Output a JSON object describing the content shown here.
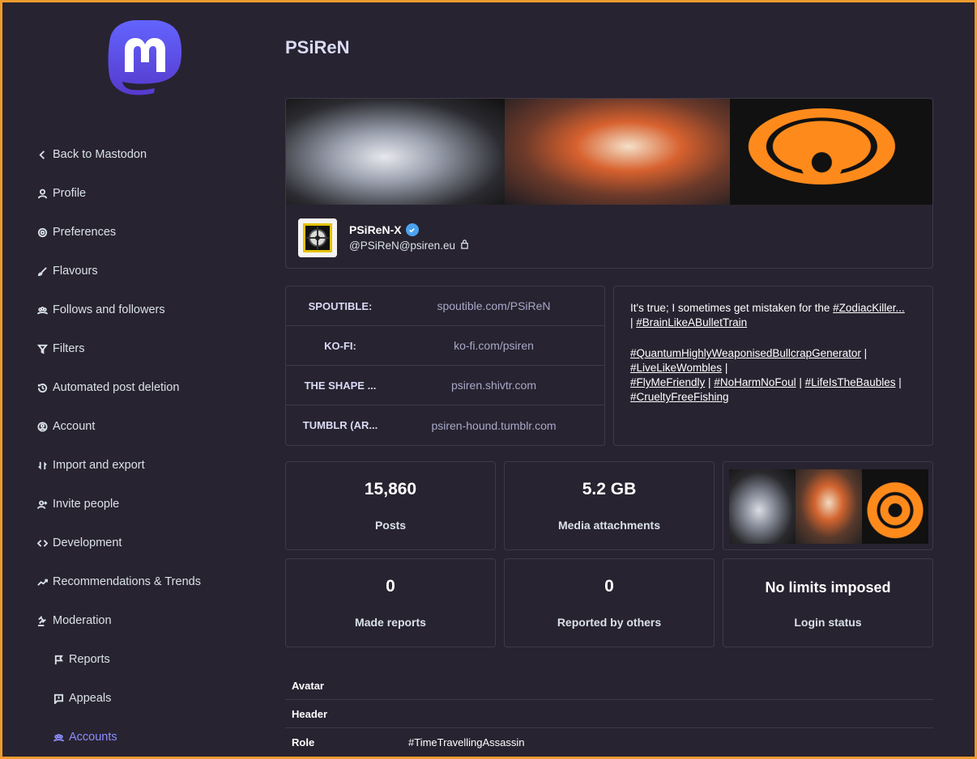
{
  "app": {
    "logo_icon": "mastodon-logo-icon"
  },
  "sidebar": {
    "items": [
      {
        "label": "Back to Mastodon",
        "icon": "chevron-left-icon"
      },
      {
        "label": "Profile",
        "icon": "user-icon"
      },
      {
        "label": "Preferences",
        "icon": "gear-icon"
      },
      {
        "label": "Flavours",
        "icon": "paint-brush-icon"
      },
      {
        "label": "Follows and followers",
        "icon": "users-icon"
      },
      {
        "label": "Filters",
        "icon": "filter-icon"
      },
      {
        "label": "Automated post deletion",
        "icon": "history-icon"
      },
      {
        "label": "Account",
        "icon": "user-circle-icon"
      },
      {
        "label": "Import and export",
        "icon": "import-export-icon"
      },
      {
        "label": "Invite people",
        "icon": "user-plus-icon"
      },
      {
        "label": "Development",
        "icon": "code-icon"
      },
      {
        "label": "Recommendations & Trends",
        "icon": "trending-icon"
      },
      {
        "label": "Moderation",
        "icon": "gavel-icon"
      },
      {
        "label": "Reports",
        "icon": "flag-icon"
      },
      {
        "label": "Appeals",
        "icon": "comment-icon"
      },
      {
        "label": "Accounts",
        "icon": "users-icon"
      }
    ]
  },
  "page": {
    "title": "PSiReN"
  },
  "profile": {
    "display_name": "PSiReN-X",
    "handle": "@PSiReN@psiren.eu",
    "verified_icon": "verified-badge-icon",
    "lock_icon": "lock-icon"
  },
  "fields": [
    {
      "name": "SPOUTIBLE:",
      "value": "spoutible.com/PSiReN"
    },
    {
      "name": "KO-FI:",
      "value": "ko-fi.com/psiren"
    },
    {
      "name": "THE SHAPE ...",
      "value": "psiren.shivtr.com"
    },
    {
      "name": "TUMBLR (AR...",
      "value": "psiren-hound.tumblr.com"
    }
  ],
  "bio": {
    "line1_text": "It's true; I sometimes get mistaken for the ",
    "line1_tag": "#ZodiacKiller...",
    "line2_sep": "| ",
    "line2_tag": "#BrainLikeABulletTrain",
    "tag3": "#QuantumHighlyWeaponisedBullcrapGenerator",
    "tag4": "#LiveLikeWombles",
    "tag5": "#FlyMeFriendly",
    "tag6": "#NoHarmNoFoul",
    "tag7": "#LifeIsTheBaubles",
    "tag8": "#CrueltyFreeFishing",
    "sep": " |"
  },
  "stats": {
    "posts": {
      "value": "15,860",
      "label": "Posts"
    },
    "media": {
      "value": "5.2 GB",
      "label": "Media attachments"
    },
    "made_reports": {
      "value": "0",
      "label": "Made reports"
    },
    "reported": {
      "value": "0",
      "label": "Reported by others"
    },
    "login": {
      "value": "No limits imposed",
      "label": "Login status"
    }
  },
  "table": {
    "rows": [
      {
        "key": "Avatar",
        "value": ""
      },
      {
        "key": "Header",
        "value": ""
      },
      {
        "key": "Role",
        "value": "#TimeTravellingAssassin"
      }
    ]
  },
  "colors": {
    "accent": "#8c8dff",
    "background": "#282330",
    "border": "#3f3a4a",
    "frame": "#ee9b2e"
  }
}
